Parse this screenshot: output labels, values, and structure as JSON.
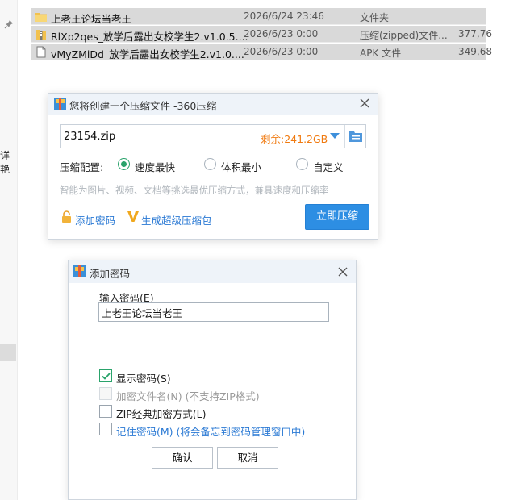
{
  "files": [
    {
      "name": "上老王论坛当老王",
      "date": "2026/6/24 23:46",
      "type": "文件夹",
      "size": "",
      "icon": "folder-icon"
    },
    {
      "name": "RlXp2qes_放学后露出女校学生2.v1.0.5....",
      "date": "2026/6/23 0:00",
      "type": "压缩(zipped)文件...",
      "size": "377,76",
      "icon": "zip-file-icon"
    },
    {
      "name": "vMyZMiDd_放学后露出女校学生2.v1.0....",
      "date": "2026/6/23 0:00",
      "type": "APK 文件",
      "size": "349,68",
      "icon": "file-icon"
    }
  ],
  "sidebar": {
    "partial_text": "详艳"
  },
  "compress_dialog": {
    "title": "您将创建一个压缩文件 -360压缩",
    "archive_name": "23154.zip",
    "remaining": "剩余:241.2GB",
    "config_label": "压缩配置:",
    "options": [
      "速度最快",
      "体积最小",
      "自定义"
    ],
    "selected_option": "速度最快",
    "hint": "智能为图片、视频、文档等挑选最优压缩方式，兼具速度和压缩率",
    "add_password": "添加密码",
    "super_pack": "生成超级压缩包",
    "compress_button": "立即压缩",
    "accent": "#2d8ee3",
    "remain_color": "#f07a10"
  },
  "password_dialog": {
    "title": "添加密码",
    "input_label": "输入密码(E)",
    "password_value": "上老王论坛当老王",
    "checkboxes": [
      {
        "label": "显示密码(S)",
        "checked": true,
        "disabled": false
      },
      {
        "label": "加密文件名(N) (不支持ZIP格式)",
        "checked": false,
        "disabled": true
      },
      {
        "label": "ZIP经典加密方式(L)",
        "checked": false,
        "disabled": false
      },
      {
        "label": "记住密码(M) (将会备忘到密码管理窗口中)",
        "checked": false,
        "disabled": false
      }
    ],
    "ok_button": "确认",
    "cancel_button": "取消"
  }
}
